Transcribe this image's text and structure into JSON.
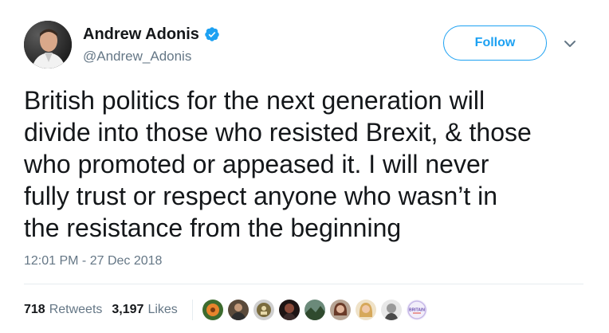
{
  "author": {
    "display_name": "Andrew Adonis",
    "handle": "@Andrew_Adonis",
    "verified": true
  },
  "follow_button": {
    "label": "Follow"
  },
  "tweet": {
    "text": "British politics for the next generation will\ndivide into those who resisted Brexit, & those\nwho promoted or appeased it. I will never\nfully trust or respect anyone who wasn’t in\nthe resistance from the beginning",
    "timestamp": "12:01 PM - 27 Dec 2018"
  },
  "stats": {
    "retweets_count": "718",
    "retweets_label": "Retweets",
    "likes_count": "3,197",
    "likes_label": "Likes"
  },
  "liker_avatars": [
    {
      "icon": "flower-avatar",
      "color": "#e8842c"
    },
    {
      "icon": "man-avatar",
      "color": "#5a4a3a"
    },
    {
      "icon": "emblem-avatar",
      "color": "#7a6b3d"
    },
    {
      "icon": "dark-portrait-avatar",
      "color": "#3b2a2a"
    },
    {
      "icon": "landscape-avatar",
      "color": "#4f6b4a"
    },
    {
      "icon": "woman-avatar",
      "color": "#8a5b45"
    },
    {
      "icon": "blonde-avatar",
      "color": "#d6a85a"
    },
    {
      "icon": "bw-portrait-avatar",
      "color": "#9a9a9a"
    },
    {
      "icon": "britain-logo-avatar",
      "color": "#c7b9e8",
      "text": "BRITAIN"
    }
  ],
  "colors": {
    "accent": "#1da1f2",
    "text": "#14171a",
    "secondary_text": "#657786",
    "divider": "#e6ecf0"
  }
}
